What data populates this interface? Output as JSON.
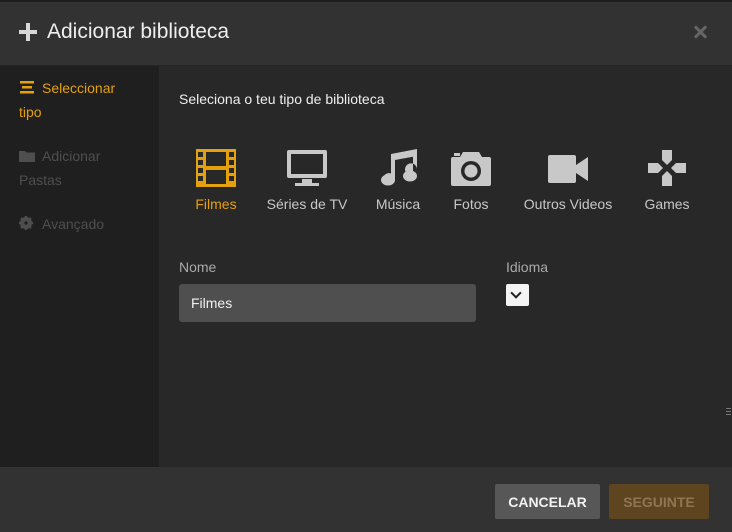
{
  "header": {
    "title": "Adicionar biblioteca"
  },
  "sidebar": {
    "items": [
      {
        "label": "Seleccionar tipo",
        "icon": "list-icon",
        "state": "active"
      },
      {
        "label": "Adicionar Pastas",
        "icon": "folder-icon",
        "state": "disabled"
      },
      {
        "label": "Avançado",
        "icon": "gear-icon",
        "state": "disabled"
      }
    ]
  },
  "main": {
    "subtitle": "Seleciona o teu tipo de biblioteca",
    "types": [
      {
        "label": "Filmes",
        "icon": "film-icon",
        "selected": true
      },
      {
        "label": "Séries de TV",
        "icon": "tv-icon",
        "selected": false
      },
      {
        "label": "Música",
        "icon": "music-note-icon",
        "selected": false
      },
      {
        "label": "Fotos",
        "icon": "camera-icon",
        "selected": false
      },
      {
        "label": "Outros Videos",
        "icon": "video-camera-icon",
        "selected": false
      },
      {
        "label": "Games",
        "icon": "gamepad-icon",
        "selected": false
      }
    ],
    "name_label": "Nome",
    "name_value": "Filmes",
    "language_label": "Idioma"
  },
  "footer": {
    "cancel_label": "CANCELAR",
    "next_label": "SEGUINTE"
  },
  "colors": {
    "accent": "#e5a00d",
    "icon": "#c8c8c8",
    "disabled": "#4e4e4e"
  }
}
